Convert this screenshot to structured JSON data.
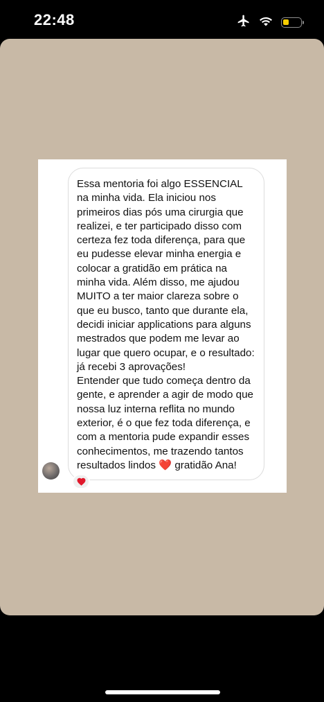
{
  "status_bar": {
    "time": "22:48",
    "icons": [
      "airplane-mode-icon",
      "wifi-icon",
      "battery-icon"
    ],
    "battery_color": "#f5cc00"
  },
  "story": {
    "background_color": "#c8b9a6",
    "message": {
      "text": "Essa mentoria foi algo ESSENCIAL na minha vida. Ela iniciou nos primeiros dias pós uma cirurgia que realizei, e ter participado disso com certeza fez toda diferença, para que eu pudesse elevar minha energia e colocar a gratidão em prática na minha vida. Além disso, me ajudou MUITO a ter maior clareza sobre o que eu busco, tanto que durante ela, decidi iniciar applications para alguns mestrados que podem me levar ao lugar que quero ocupar, e o resultado: já recebi 3 aprovações!\nEntender que tudo começa dentro da gente, e aprender a agir de modo que nossa luz interna reflita no mundo exterior, é o que fez toda diferença, e com a mentoria pude expandir esses conhecimentos, me trazendo tantos resultados lindos ❤️ gratidão Ana!",
      "reaction": "❤️"
    }
  }
}
